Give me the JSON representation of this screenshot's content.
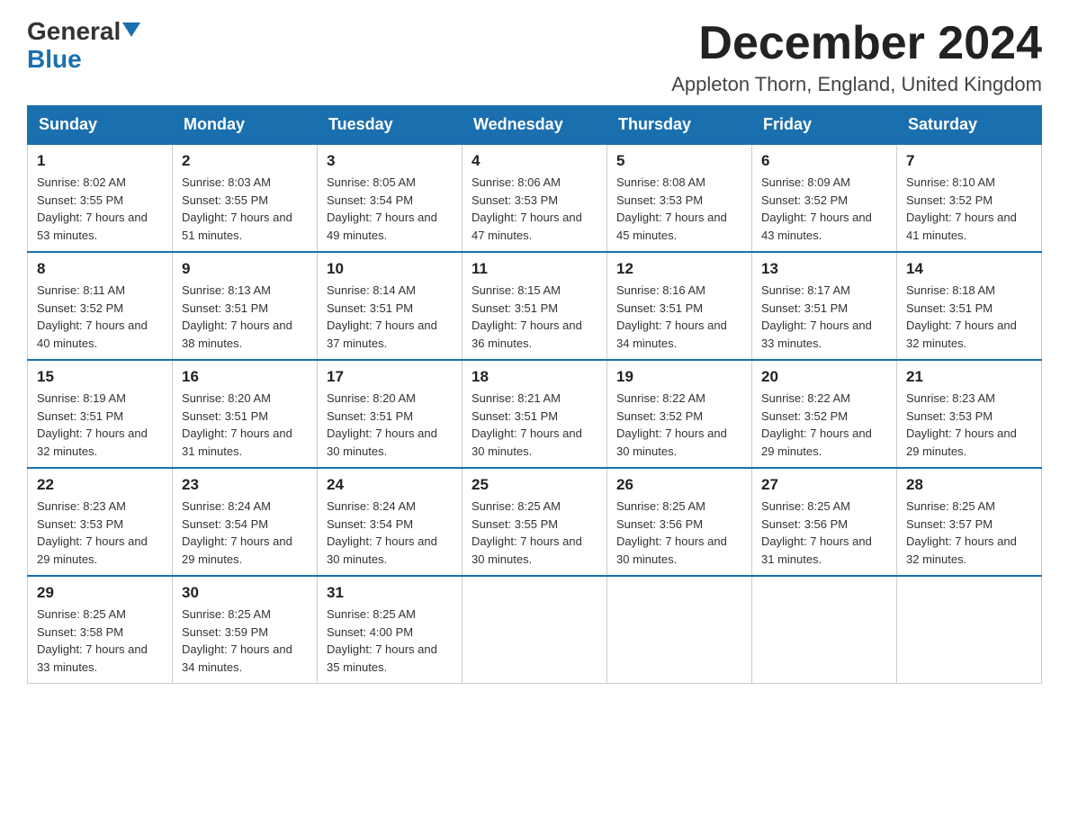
{
  "header": {
    "logo_general": "General",
    "logo_blue": "Blue",
    "month_title": "December 2024",
    "location": "Appleton Thorn, England, United Kingdom"
  },
  "weekdays": [
    "Sunday",
    "Monday",
    "Tuesday",
    "Wednesday",
    "Thursday",
    "Friday",
    "Saturday"
  ],
  "weeks": [
    [
      {
        "day": "1",
        "sunrise": "Sunrise: 8:02 AM",
        "sunset": "Sunset: 3:55 PM",
        "daylight": "Daylight: 7 hours and 53 minutes."
      },
      {
        "day": "2",
        "sunrise": "Sunrise: 8:03 AM",
        "sunset": "Sunset: 3:55 PM",
        "daylight": "Daylight: 7 hours and 51 minutes."
      },
      {
        "day": "3",
        "sunrise": "Sunrise: 8:05 AM",
        "sunset": "Sunset: 3:54 PM",
        "daylight": "Daylight: 7 hours and 49 minutes."
      },
      {
        "day": "4",
        "sunrise": "Sunrise: 8:06 AM",
        "sunset": "Sunset: 3:53 PM",
        "daylight": "Daylight: 7 hours and 47 minutes."
      },
      {
        "day": "5",
        "sunrise": "Sunrise: 8:08 AM",
        "sunset": "Sunset: 3:53 PM",
        "daylight": "Daylight: 7 hours and 45 minutes."
      },
      {
        "day": "6",
        "sunrise": "Sunrise: 8:09 AM",
        "sunset": "Sunset: 3:52 PM",
        "daylight": "Daylight: 7 hours and 43 minutes."
      },
      {
        "day": "7",
        "sunrise": "Sunrise: 8:10 AM",
        "sunset": "Sunset: 3:52 PM",
        "daylight": "Daylight: 7 hours and 41 minutes."
      }
    ],
    [
      {
        "day": "8",
        "sunrise": "Sunrise: 8:11 AM",
        "sunset": "Sunset: 3:52 PM",
        "daylight": "Daylight: 7 hours and 40 minutes."
      },
      {
        "day": "9",
        "sunrise": "Sunrise: 8:13 AM",
        "sunset": "Sunset: 3:51 PM",
        "daylight": "Daylight: 7 hours and 38 minutes."
      },
      {
        "day": "10",
        "sunrise": "Sunrise: 8:14 AM",
        "sunset": "Sunset: 3:51 PM",
        "daylight": "Daylight: 7 hours and 37 minutes."
      },
      {
        "day": "11",
        "sunrise": "Sunrise: 8:15 AM",
        "sunset": "Sunset: 3:51 PM",
        "daylight": "Daylight: 7 hours and 36 minutes."
      },
      {
        "day": "12",
        "sunrise": "Sunrise: 8:16 AM",
        "sunset": "Sunset: 3:51 PM",
        "daylight": "Daylight: 7 hours and 34 minutes."
      },
      {
        "day": "13",
        "sunrise": "Sunrise: 8:17 AM",
        "sunset": "Sunset: 3:51 PM",
        "daylight": "Daylight: 7 hours and 33 minutes."
      },
      {
        "day": "14",
        "sunrise": "Sunrise: 8:18 AM",
        "sunset": "Sunset: 3:51 PM",
        "daylight": "Daylight: 7 hours and 32 minutes."
      }
    ],
    [
      {
        "day": "15",
        "sunrise": "Sunrise: 8:19 AM",
        "sunset": "Sunset: 3:51 PM",
        "daylight": "Daylight: 7 hours and 32 minutes."
      },
      {
        "day": "16",
        "sunrise": "Sunrise: 8:20 AM",
        "sunset": "Sunset: 3:51 PM",
        "daylight": "Daylight: 7 hours and 31 minutes."
      },
      {
        "day": "17",
        "sunrise": "Sunrise: 8:20 AM",
        "sunset": "Sunset: 3:51 PM",
        "daylight": "Daylight: 7 hours and 30 minutes."
      },
      {
        "day": "18",
        "sunrise": "Sunrise: 8:21 AM",
        "sunset": "Sunset: 3:51 PM",
        "daylight": "Daylight: 7 hours and 30 minutes."
      },
      {
        "day": "19",
        "sunrise": "Sunrise: 8:22 AM",
        "sunset": "Sunset: 3:52 PM",
        "daylight": "Daylight: 7 hours and 30 minutes."
      },
      {
        "day": "20",
        "sunrise": "Sunrise: 8:22 AM",
        "sunset": "Sunset: 3:52 PM",
        "daylight": "Daylight: 7 hours and 29 minutes."
      },
      {
        "day": "21",
        "sunrise": "Sunrise: 8:23 AM",
        "sunset": "Sunset: 3:53 PM",
        "daylight": "Daylight: 7 hours and 29 minutes."
      }
    ],
    [
      {
        "day": "22",
        "sunrise": "Sunrise: 8:23 AM",
        "sunset": "Sunset: 3:53 PM",
        "daylight": "Daylight: 7 hours and 29 minutes."
      },
      {
        "day": "23",
        "sunrise": "Sunrise: 8:24 AM",
        "sunset": "Sunset: 3:54 PM",
        "daylight": "Daylight: 7 hours and 29 minutes."
      },
      {
        "day": "24",
        "sunrise": "Sunrise: 8:24 AM",
        "sunset": "Sunset: 3:54 PM",
        "daylight": "Daylight: 7 hours and 30 minutes."
      },
      {
        "day": "25",
        "sunrise": "Sunrise: 8:25 AM",
        "sunset": "Sunset: 3:55 PM",
        "daylight": "Daylight: 7 hours and 30 minutes."
      },
      {
        "day": "26",
        "sunrise": "Sunrise: 8:25 AM",
        "sunset": "Sunset: 3:56 PM",
        "daylight": "Daylight: 7 hours and 30 minutes."
      },
      {
        "day": "27",
        "sunrise": "Sunrise: 8:25 AM",
        "sunset": "Sunset: 3:56 PM",
        "daylight": "Daylight: 7 hours and 31 minutes."
      },
      {
        "day": "28",
        "sunrise": "Sunrise: 8:25 AM",
        "sunset": "Sunset: 3:57 PM",
        "daylight": "Daylight: 7 hours and 32 minutes."
      }
    ],
    [
      {
        "day": "29",
        "sunrise": "Sunrise: 8:25 AM",
        "sunset": "Sunset: 3:58 PM",
        "daylight": "Daylight: 7 hours and 33 minutes."
      },
      {
        "day": "30",
        "sunrise": "Sunrise: 8:25 AM",
        "sunset": "Sunset: 3:59 PM",
        "daylight": "Daylight: 7 hours and 34 minutes."
      },
      {
        "day": "31",
        "sunrise": "Sunrise: 8:25 AM",
        "sunset": "Sunset: 4:00 PM",
        "daylight": "Daylight: 7 hours and 35 minutes."
      },
      null,
      null,
      null,
      null
    ]
  ]
}
